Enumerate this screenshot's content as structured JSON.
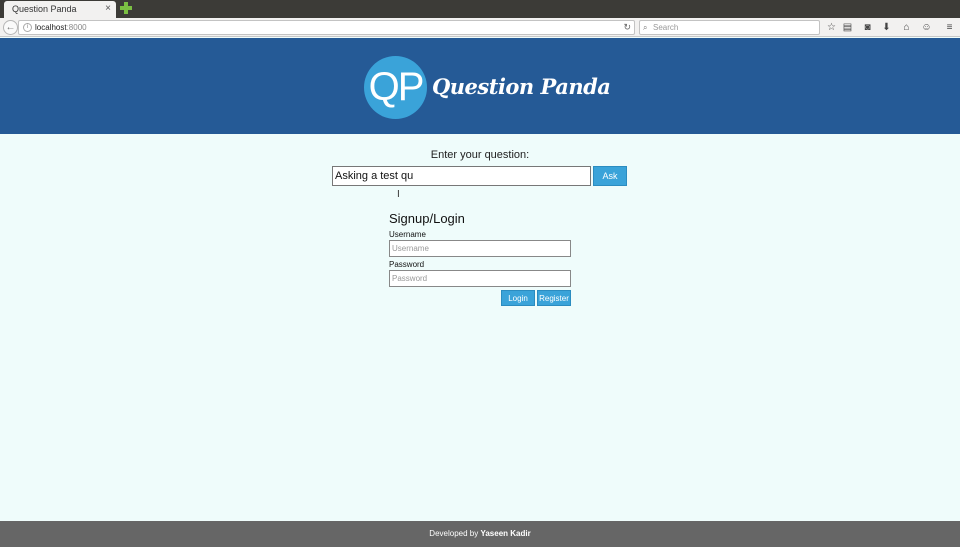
{
  "browser": {
    "tab_title": "Question Panda",
    "tab_close": "×",
    "url_host": "localhost",
    "url_port": ":8000",
    "search_placeholder": "Search",
    "toolbar_icons": [
      "bookmark-star-icon",
      "reading-list-icon",
      "pocket-icon",
      "download-icon",
      "home-icon",
      "chat-icon",
      "menu-icon"
    ]
  },
  "header": {
    "logo_text": "QP",
    "brand_name": "Question Panda"
  },
  "question": {
    "label": "Enter your question:",
    "value": "Asking a test qu",
    "ask_label": "Ask"
  },
  "auth": {
    "title": "Signup/Login",
    "username_label": "Username",
    "username_placeholder": "Username",
    "password_label": "Password",
    "password_placeholder": "Password",
    "login_label": "Login",
    "register_label": "Register"
  },
  "footer": {
    "prefix": "Developed by",
    "author": "Yaseen Kadir"
  },
  "colors": {
    "header_bg": "#255a96",
    "accent": "#3aa3d9",
    "page_bg": "#effcfb",
    "footer_bg": "#666666"
  }
}
